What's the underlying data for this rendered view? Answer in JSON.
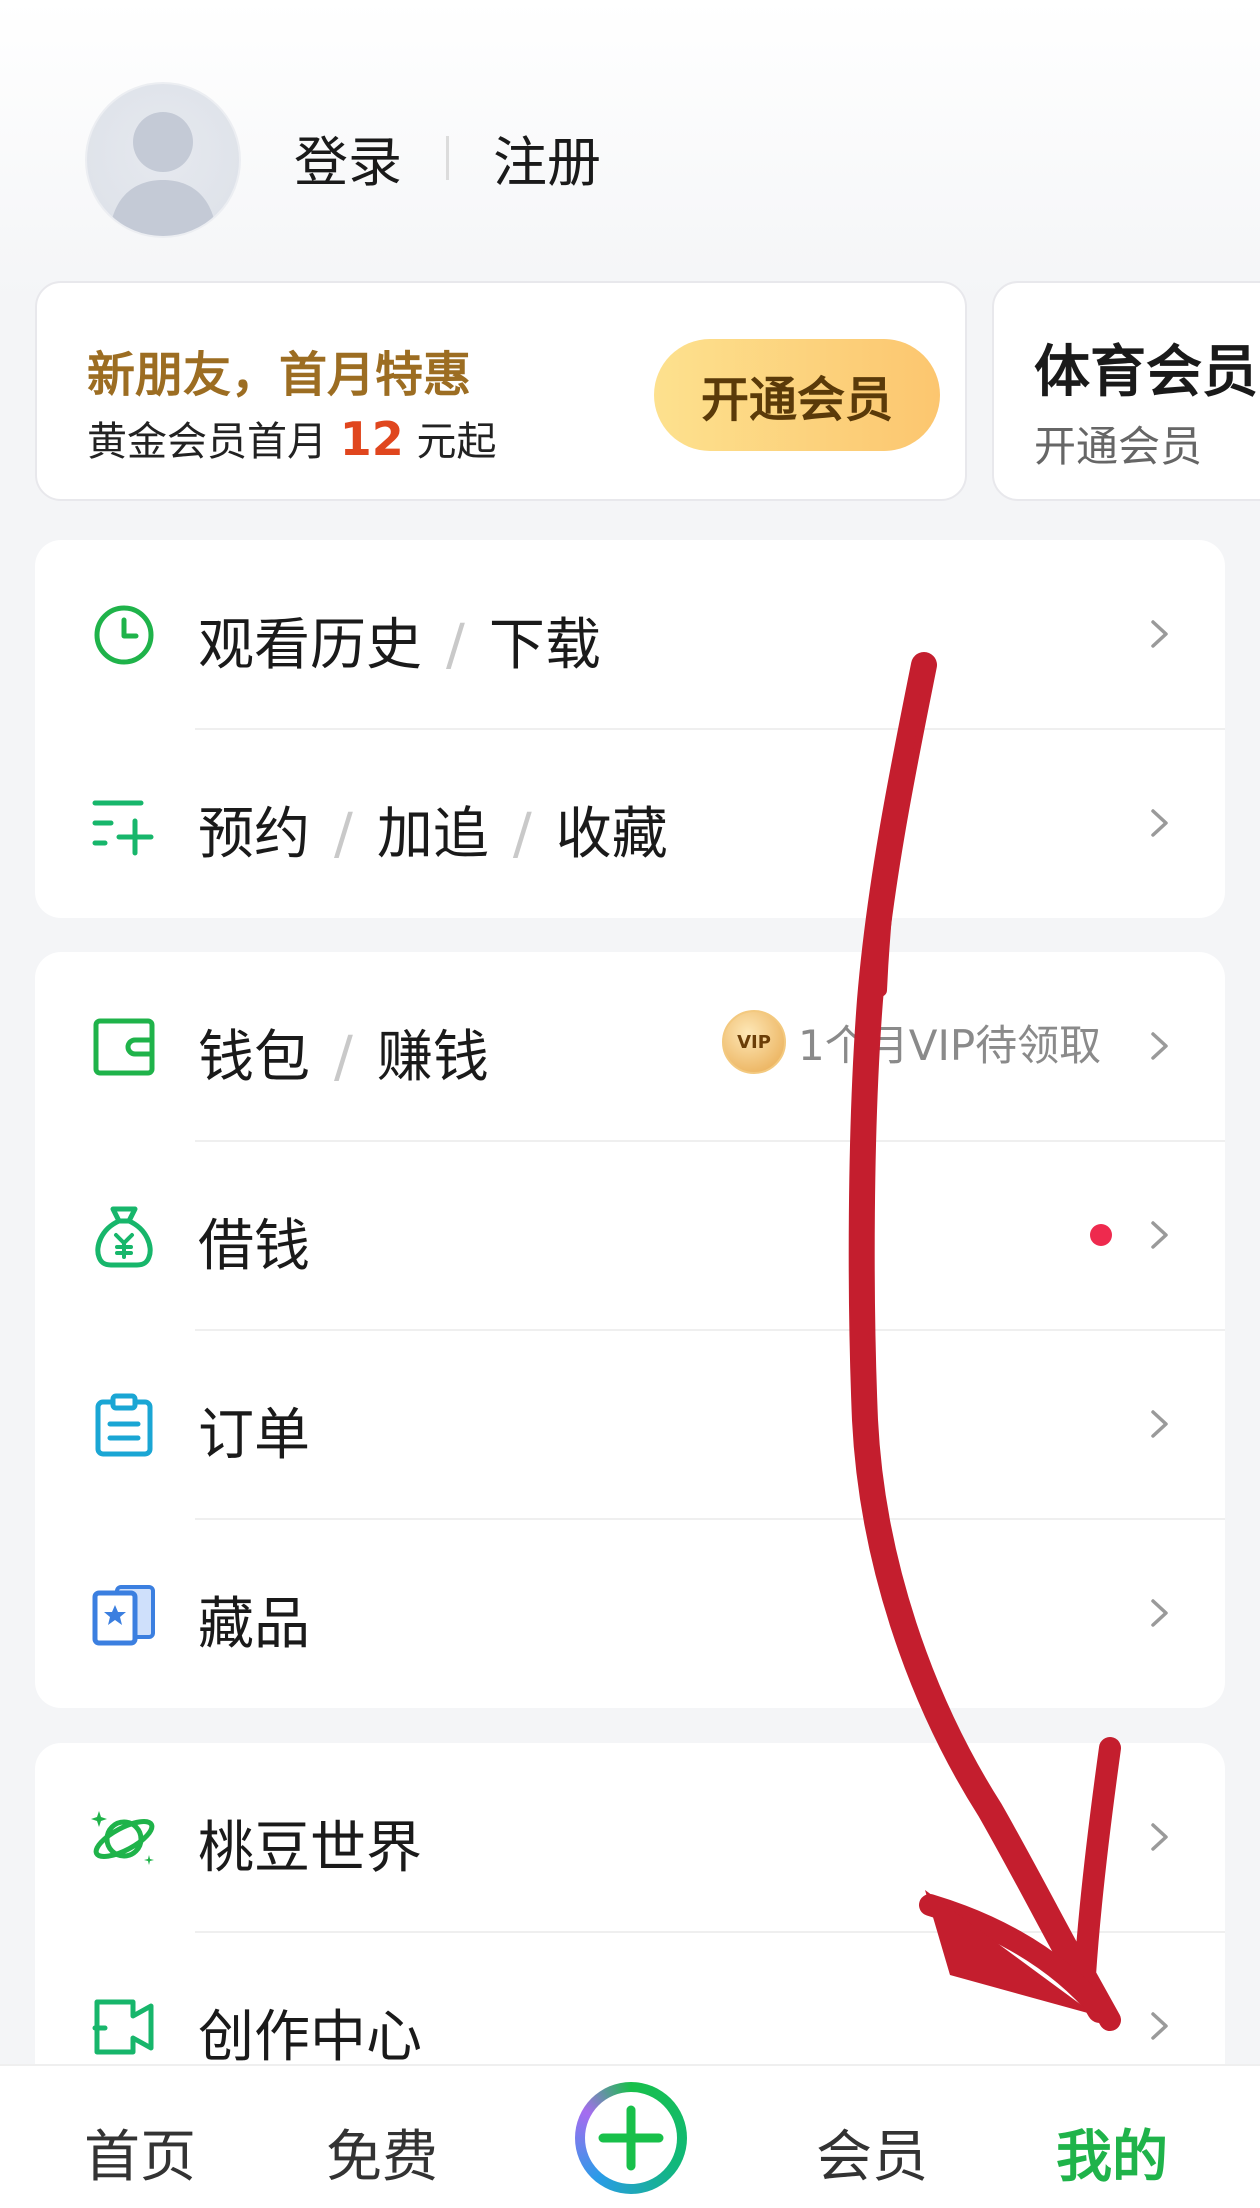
{
  "header": {
    "login_label": "登录",
    "register_label": "注册"
  },
  "promo": {
    "title": "新朋友，首月特惠",
    "subtitle_prefix": "黄金会员首月 ",
    "price": "12",
    "subtitle_suffix": " 元起",
    "button_label": "开通会员"
  },
  "sports_card": {
    "title": "体育会员",
    "subtitle": "开通会员"
  },
  "menu_group_1": [
    {
      "icon": "clock-icon",
      "parts": [
        "观看历史",
        "下载"
      ]
    },
    {
      "icon": "list-add-icon",
      "parts": [
        "预约",
        "加追",
        "收藏"
      ]
    }
  ],
  "menu_group_2": [
    {
      "icon": "wallet-icon",
      "parts": [
        "钱包",
        "赚钱"
      ],
      "extra_badge": "VIP",
      "extra_text": "1个月VIP待领取"
    },
    {
      "icon": "money-bag-icon",
      "parts": [
        "借钱"
      ]
    },
    {
      "icon": "clipboard-icon",
      "parts": [
        "订单"
      ]
    },
    {
      "icon": "collectible-card-icon",
      "parts": [
        "藏品"
      ]
    }
  ],
  "menu_group_3": [
    {
      "icon": "planet-icon",
      "parts": [
        "桃豆世界"
      ]
    },
    {
      "icon": "camera-icon",
      "parts": [
        "创作中心"
      ]
    }
  ],
  "tabbar": {
    "home": "首页",
    "free": "免费",
    "member": "会员",
    "mine": "我的"
  },
  "colors": {
    "accent_green": "#1fb34a",
    "promo_gold": "#9c6d22",
    "price_red": "#e0461e",
    "annotation_red": "#c41e2e"
  }
}
